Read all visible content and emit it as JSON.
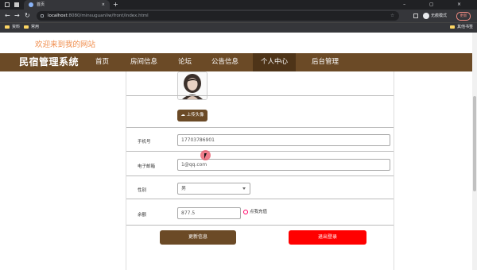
{
  "browser": {
    "tab_title": "首页",
    "tab_close": "×",
    "new_tab": "+",
    "window_controls": "–  ◻  ×",
    "nav": {
      "back": "←",
      "forward": "→",
      "reload": "↻"
    },
    "url_host": "localhost",
    "url_path": ":8080/minsuguanliw/front/index.html",
    "star": "☆",
    "profile": "无痕模式",
    "update_label": "更新",
    "bookmarks": [
      "资料",
      "常用"
    ],
    "other_bookmarks": "其他书签"
  },
  "page": {
    "welcome": "欢迎来到我的网站",
    "brand": "民宿管理系统",
    "nav": [
      "首页",
      "房间信息",
      "论坛",
      "公告信息",
      "个人中心",
      "后台管理"
    ],
    "active_nav_index": 4
  },
  "profile_form": {
    "upload_label": "上传头像",
    "phone": {
      "label": "手机号",
      "value": "17703786901"
    },
    "email": {
      "label": "电子邮箱",
      "value": "1@qq.com"
    },
    "gender": {
      "label": "性别",
      "value": "男"
    },
    "balance": {
      "label": "余额",
      "value": "877.5"
    },
    "recharge_label": "点我充值",
    "update_button": "更新信息",
    "logout_button": "退出登录"
  },
  "colors": {
    "brand_brown": "#6b4a26",
    "active_brown": "#4e3418",
    "logout_red": "#ff0000",
    "welcome_orange": "#f08c4b"
  }
}
